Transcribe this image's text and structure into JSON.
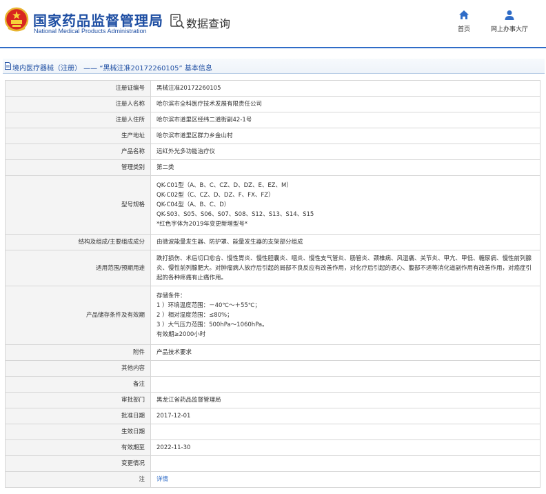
{
  "header": {
    "brand_cn": "国家药品监督管理局",
    "brand_en": "National Medical Products Administration",
    "section_title": "数据查询",
    "nav": [
      {
        "label": "首页",
        "icon": "home-icon"
      },
      {
        "label": "网上办事大厅",
        "icon": "user-icon"
      }
    ],
    "accent_color": "#2f6cc7",
    "brand_color": "#1f4fa3"
  },
  "breadcrumb": {
    "text": "境内医疗器械（注册） —— “黑械注准20172260105” 基本信息",
    "icon": "document-icon"
  },
  "table": {
    "rows": [
      {
        "label": "注册证编号",
        "value": "黑械注准20172260105"
      },
      {
        "label": "注册人名称",
        "value": "哈尔滨市全科医疗技术发展有限责任公司"
      },
      {
        "label": "注册人住所",
        "value": "哈尔滨市道里区经纬二道街副42-1号"
      },
      {
        "label": "生产地址",
        "value": "哈尔滨市道里区群力乡金山村"
      },
      {
        "label": "产品名称",
        "value": "远红外光多功能治疗仪"
      },
      {
        "label": "管理类别",
        "value": "第二类"
      },
      {
        "label": "型号规格",
        "lines": [
          "QK-C01型（A、B、C、CZ、D、DZ、E、EZ、M）",
          "QK-C02型（C、CZ、D、DZ、F、FX、FZ）",
          "QK-C04型（A、B、C、D）",
          "QK-S03、S05、S06、S07、S08、S12、S13、S14、S15",
          "*红色字体为2019年变更新增型号*"
        ]
      },
      {
        "label": "结构及组成/主要组成成分",
        "value": "由微波能量发生器、防护罩、能量发生器的支架部分组成"
      },
      {
        "label": "适用范围/预期用途",
        "value": "跌打损伤、术后切口愈合、慢性胃炎、慢性胆囊炎、咽炎、慢性支气管炎、肠管炎、颈椎病、风湿痛、关节炎、甲亢、甲低、糖尿病、慢性前列腺炎、慢性前列腺肥大。对肿瘤病人放疗后引起的局部不良反应有改善作用，对化疗后引起的恶心、腹部不适等消化道副作用有改善作用，对癌症引起的各种疼痛有止痛作用。"
      },
      {
        "label": "产品储存条件及有效期",
        "lines": [
          "存储条件：",
          "1 ）环境温度范围：－40℃～＋55℃；",
          "2 ）相对湿度范围：≤80%；",
          "3 ）大气压力范围：500hPa～1060hPa。",
          "有效期≥2000小时"
        ]
      },
      {
        "label": "附件",
        "value": "产品技术要求"
      },
      {
        "label": "其他内容",
        "value": ""
      },
      {
        "label": "备注",
        "value": ""
      },
      {
        "label": "审批部门",
        "value": "黑龙江省药品监督管理局"
      },
      {
        "label": "批准日期",
        "value": "2017-12-01"
      },
      {
        "label": "生效日期",
        "value": ""
      },
      {
        "label": "有效期至",
        "value": "2022-11-30"
      },
      {
        "label": "变更情况",
        "value": ""
      },
      {
        "label": "注",
        "value": "详情"
      }
    ]
  }
}
